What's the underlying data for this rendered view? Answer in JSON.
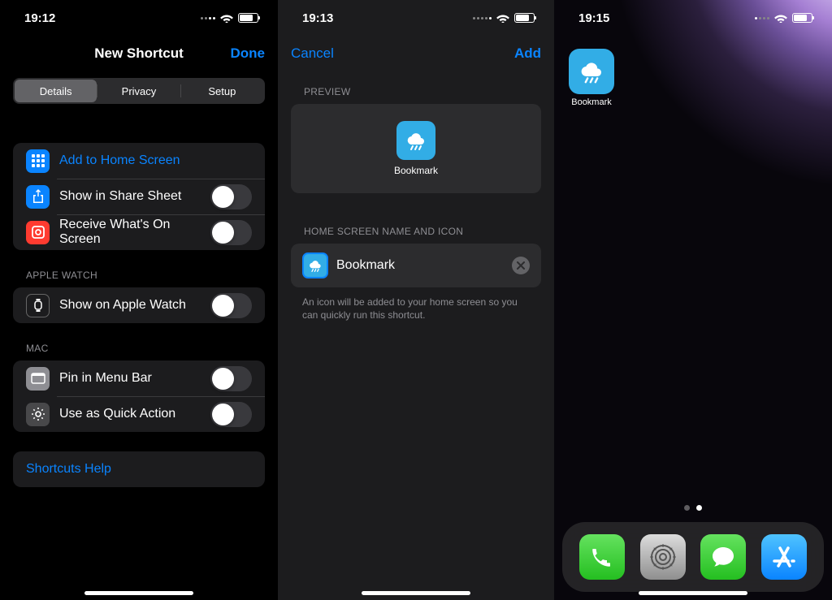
{
  "screens": {
    "shortcut": {
      "time": "19:12",
      "nav": {
        "title": "New Shortcut",
        "done": "Done"
      },
      "segments": {
        "details": "Details",
        "privacy": "Privacy",
        "setup": "Setup"
      },
      "rows": {
        "addHome": "Add to Home Screen",
        "shareSheet": "Show in Share Sheet",
        "receive": "Receive What's On Screen",
        "watchHeader": "Apple Watch",
        "showWatch": "Show on Apple Watch",
        "macHeader": "Mac",
        "pinMenu": "Pin in Menu Bar",
        "quickAction": "Use as Quick Action",
        "help": "Shortcuts Help"
      }
    },
    "addHome": {
      "time": "19:13",
      "nav": {
        "cancel": "Cancel",
        "add": "Add"
      },
      "previewHeader": "Preview",
      "previewLabel": "Bookmark",
      "nameHeader": "Home Screen Name and Icon",
      "nameValue": "Bookmark",
      "footer": "An icon will be added to your home screen so you can quickly run this shortcut."
    },
    "home": {
      "time": "19:15",
      "appLabel": "Bookmark"
    }
  }
}
